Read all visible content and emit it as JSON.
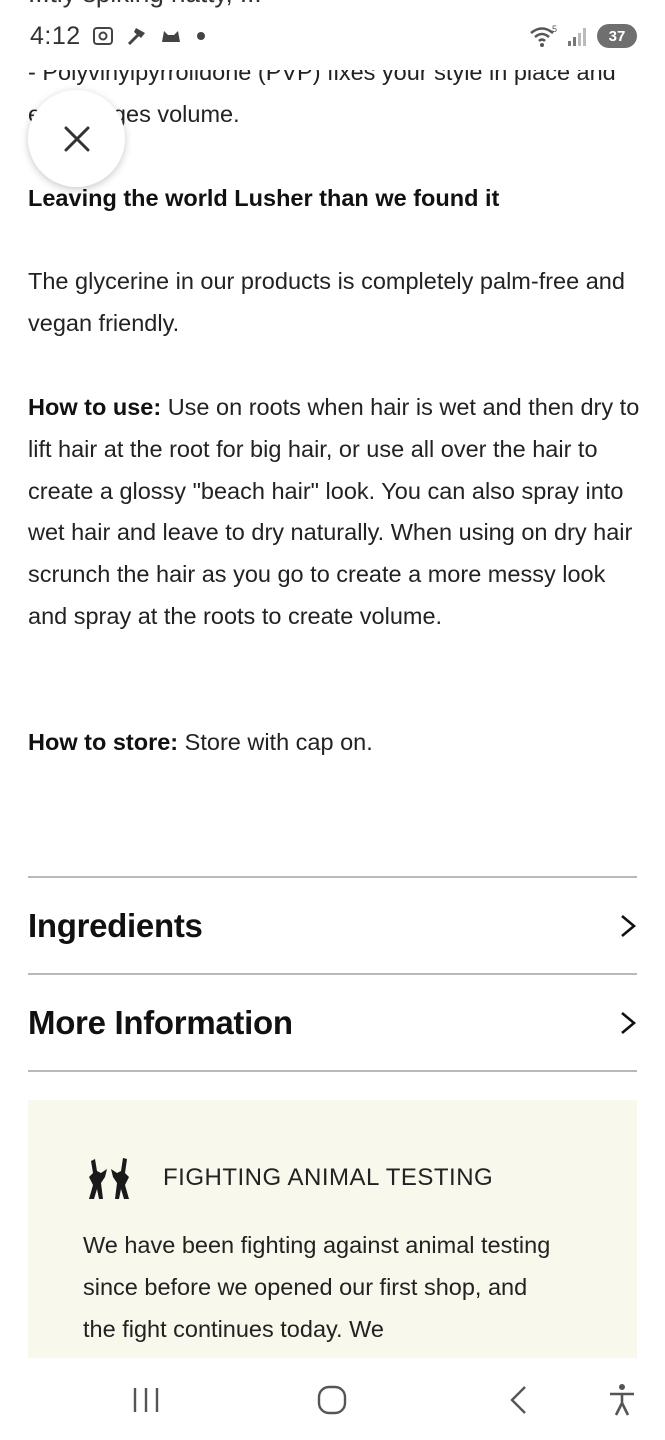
{
  "status_bar": {
    "time": "4:12",
    "battery": "37",
    "wifi_label": "5",
    "peek_text": "...tly spiking natty, ..."
  },
  "content": {
    "p1": "- Polyvinylpyrrolidone (PVP) fixes your style in place and encourages volume.",
    "lusher_heading": "Leaving the world Lusher than we found it",
    "glycerine": "The glycerine in our products is completely palm-free and vegan friendly.",
    "how_to_use_label": "How to use:",
    "how_to_use_text": " Use on roots when hair is wet and then dry to lift hair at the root for big hair, or use all over the hair to create a glossy \"beach hair\" look. You can also spray into wet hair and leave to dry naturally. When using on dry hair scrunch the hair as you go to create a more messy look and spray at the roots to create volume.",
    "how_to_store_label": "How to store:",
    "how_to_store_text": " Store with cap on."
  },
  "accordion": {
    "ingredients": "Ingredients",
    "more_information": "More Information"
  },
  "fighting_animal_testing": {
    "title": "FIGHTING ANIMAL TESTING",
    "body": "We have been fighting against animal testing since before we opened our first shop, and the fight continues today. We"
  },
  "icons": {
    "close": "close-icon",
    "chevron": "chevron-right-icon",
    "hares": "hares-icon"
  },
  "colors": {
    "card_bg": "#f9f8ec",
    "divider": "#b9b9b9",
    "text": "#222222"
  }
}
